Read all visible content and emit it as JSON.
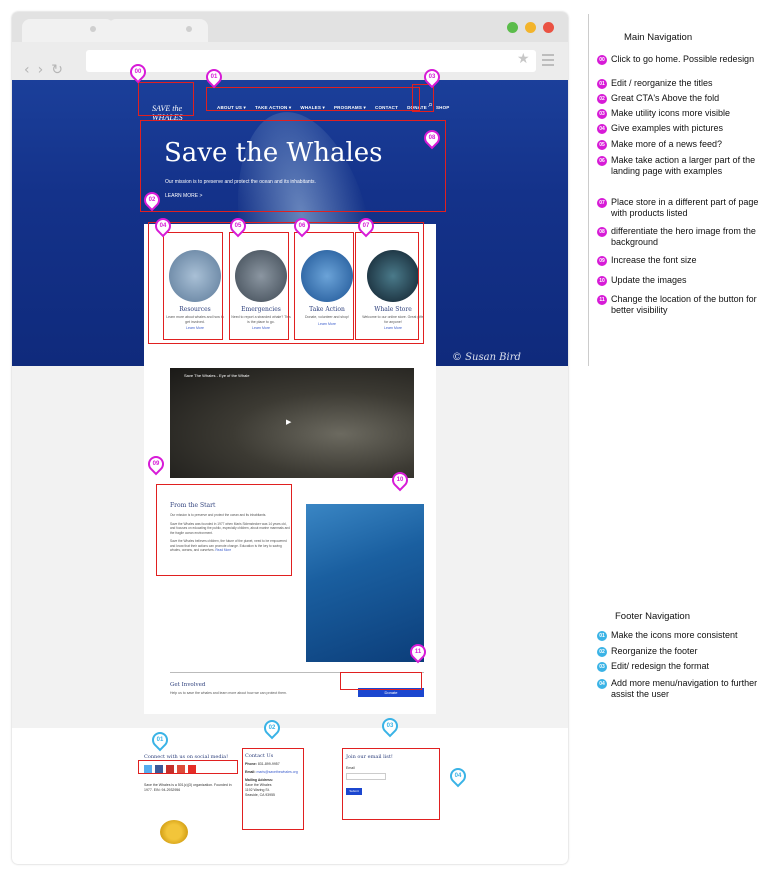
{
  "site": {
    "logo_text": "SAVE the WHALES",
    "nav": [
      "ABOUT US ▾",
      "TAKE ACTION ▾",
      "WHALES ▾",
      "PROGRAMS ▾",
      "CONTACT",
      "DONATE",
      "SHOP",
      "🔍"
    ],
    "hero_title": "Save the Whales",
    "hero_subtitle": "Our mission is to preserve and protect the ocean and its inhabitants.",
    "hero_link": "LEARN MORE >",
    "signature": "© Susan Bird",
    "cards": [
      {
        "title": "Resources",
        "text": "Learn more about whales and how to get involved.",
        "link": "Learn More",
        "color": "#7c9ab8"
      },
      {
        "title": "Emergencies",
        "text": "Need to report a stranded whale? This is the place to go.",
        "link": "Learn More",
        "color": "#4d5c6a"
      },
      {
        "title": "Take Action",
        "text": "Donate, volunteer and shop!",
        "link": "Learn More",
        "color": "#2d6ab0"
      },
      {
        "title": "Whale Store",
        "text": "Welcome to our online store. Great gifts for anyone!",
        "link": "Learn More",
        "color": "#1d2b3a"
      }
    ],
    "video_title": "Save The Whales - Eye of the Whale",
    "from_start": {
      "title": "From the Start",
      "p1": "Our mission is to preserve and protect the ocean and its inhabitants.",
      "p2": "Save the Whales was founded in 1977 when Maris Sidenstecker was 14 years old, and focuses on educating the public, especially children, about marine mammals and the fragile ocean environment.",
      "p3": "Save the Whales believes children, the future of the planet, need to be empowered and know that their actions can promote change. Education is the key to saving whales, oceans, and ourselves.",
      "read_more": "Read More"
    },
    "get_involved": {
      "title": "Get Involved",
      "text": "Help us to save the whales and learn more about how we can protect them.",
      "button": "Donate"
    },
    "footer": {
      "social_title": "Connect with us on social media!",
      "about": "Save the Whales is a 501(c)(3) organization. Founded in 1977. EIN: 94-2932956",
      "contact_title": "Contact Us",
      "phone_label": "Phone:",
      "phone": "831-899-9957",
      "email_label": "Email:",
      "email": "maris@savethewhales.org",
      "mailing_label": "Mailing Address:",
      "mailing": [
        "Save the Whales",
        "1192 Waring St.",
        "Seaside, CA 93955"
      ],
      "email_title": "Join our email list!",
      "email_field_label": "Email",
      "submit": "Submit"
    }
  },
  "pins_main": [
    "00",
    "01",
    "03",
    "02",
    "04",
    "05",
    "06",
    "07",
    "08",
    "09",
    "10",
    "11"
  ],
  "pins_footer": [
    "01",
    "02",
    "03",
    "04"
  ],
  "main_nav_notes": {
    "title": "Main Navigation",
    "items": [
      {
        "num": "00",
        "text": "Click to go home. Possible redesign"
      },
      {
        "num": "01",
        "text": "Edit / reorganize the titles"
      },
      {
        "num": "02",
        "text": "Great CTA's Above the fold"
      },
      {
        "num": "03",
        "text": "Make utility icons more visible"
      },
      {
        "num": "04",
        "text": "Give examples with pictures"
      },
      {
        "num": "05",
        "text": "Make more of a news feed?"
      },
      {
        "num": "06",
        "text": "Make take action a larger part of the landing page with examples"
      },
      {
        "num": "07",
        "text": "Place store in a different part of page with products listed"
      },
      {
        "num": "08",
        "text": "differentiate the hero image from the background"
      },
      {
        "num": "09",
        "text": "Increase the font size"
      },
      {
        "num": "10",
        "text": "Update the images"
      },
      {
        "num": "11",
        "text": "Change the location of the button for better visibility"
      }
    ]
  },
  "footer_nav_notes": {
    "title": "Footer Navigation",
    "items": [
      {
        "num": "01",
        "text": "Make the icons more consistent"
      },
      {
        "num": "02",
        "text": "Reorganize the footer"
      },
      {
        "num": "03",
        "text": "Edit/ redesign the format"
      },
      {
        "num": "04",
        "text": "Add more menu/navigation to further assist the user"
      }
    ]
  },
  "colors": {
    "annotation_magenta": "#d71bd7",
    "annotation_cyan": "#3ab3e6",
    "annotation_box": "#e02020",
    "hero_blue": "#1b3f9a",
    "button_blue": "#1b46cf"
  }
}
